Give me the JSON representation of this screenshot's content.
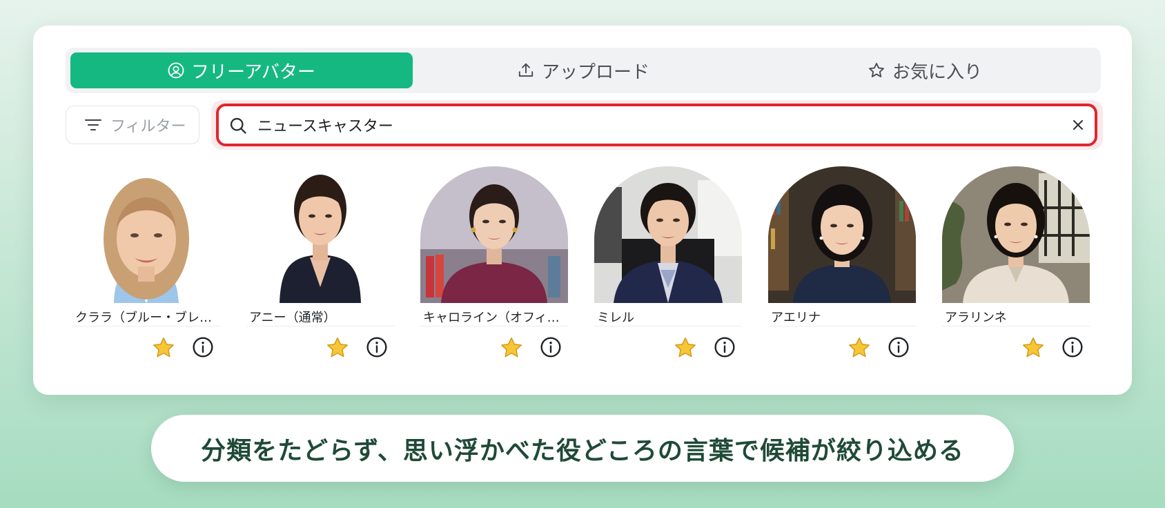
{
  "tabs": [
    {
      "label": "フリーアバター",
      "icon": "user-circle-icon",
      "active": true
    },
    {
      "label": "アップロード",
      "icon": "upload-icon",
      "active": false
    },
    {
      "label": "お気に入り",
      "icon": "star-outline-icon",
      "active": false
    }
  ],
  "filter": {
    "label": "フィルター",
    "icon": "filter-icon"
  },
  "search": {
    "value": "ニュースキャスター",
    "icon": "search-icon",
    "clear_icon": "close-icon"
  },
  "avatars": [
    {
      "name": "クララ（ブルー・ブレ…"
    },
    {
      "name": "アニー（通常）"
    },
    {
      "name": "キャロライン（オフィ…"
    },
    {
      "name": "ミレル"
    },
    {
      "name": "アエリナ"
    },
    {
      "name": "アラリンネ"
    }
  ],
  "caption": "分類をたどらず、思い浮かべた役どころの言葉で候補が絞り込める",
  "colors": {
    "accent": "#16b881",
    "search_border": "#e0262e",
    "star": "#f6c637",
    "caption_text": "#1f4a38"
  }
}
